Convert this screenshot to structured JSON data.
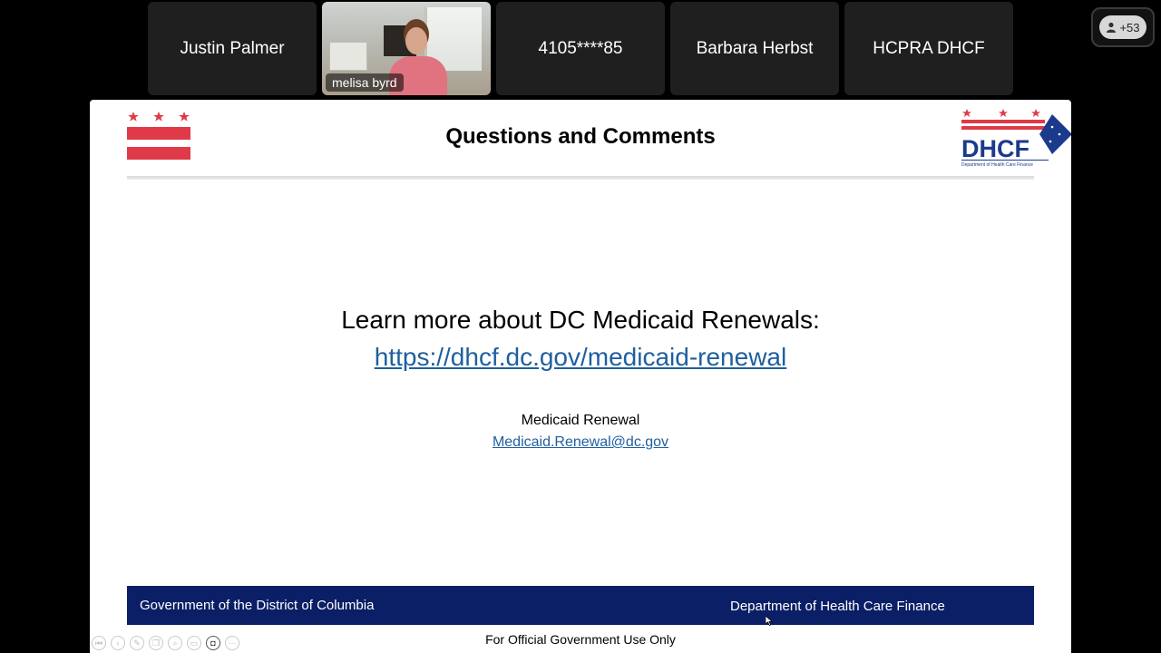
{
  "participants": [
    {
      "name": "Justin Palmer",
      "video": false
    },
    {
      "name": "melisa byrd",
      "video": true
    },
    {
      "name": "4105****85",
      "video": false
    },
    {
      "name": "Barbara Herbst",
      "video": false
    },
    {
      "name": "HCPRA DHCF",
      "video": false
    }
  ],
  "overflow": {
    "count_label": "+53",
    "icon": "person-icon"
  },
  "slide": {
    "title": "Questions and Comments",
    "logo_text": "DHCF",
    "logo_subtext": "Department of Health Care Finance",
    "learn_more": "Learn more about DC Medicaid Renewals:",
    "link": "https://dhcf.dc.gov/medicaid-renewal",
    "contact_label": "Medicaid Renewal",
    "contact_email": "Medicaid.Renewal@dc.gov",
    "footer_left": "Government of the District of Columbia",
    "footer_right": "Department of Health Care Finance",
    "official_use": "For Official Government Use Only"
  },
  "colors": {
    "flag_red": "#e03a48",
    "navy": "#0b1f66",
    "link": "#1f5f9e",
    "logo_blue": "#1b3a8c"
  },
  "slide_tools": [
    "first-page-icon",
    "prev-icon",
    "pen-icon",
    "copy-icon",
    "zoom-icon",
    "screen-icon",
    "camera-icon",
    "more-icon"
  ]
}
